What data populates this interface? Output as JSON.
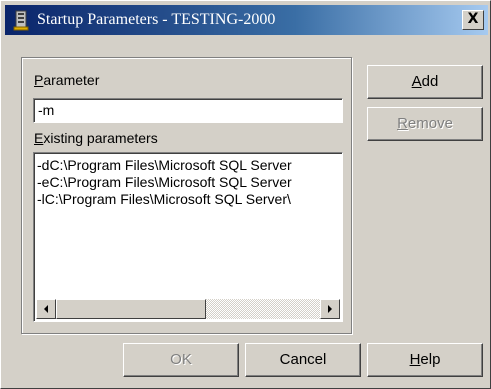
{
  "window": {
    "title": "Startup Parameters - TESTING-2000",
    "close_glyph": "X"
  },
  "parameter": {
    "label_mnemonic": "P",
    "label_rest": "arameter",
    "value": "-m"
  },
  "existing": {
    "label_mnemonic": "E",
    "label_rest": "xisting parameters",
    "items": [
      "-dC:\\Program Files\\Microsoft SQL Server",
      "-eC:\\Program Files\\Microsoft SQL Server",
      "-lC:\\Program Files\\Microsoft SQL Server\\"
    ]
  },
  "buttons": {
    "add": {
      "mnemonic": "A",
      "rest": "dd"
    },
    "remove": {
      "mnemonic": "R",
      "rest": "emove"
    },
    "ok": "OK",
    "cancel": "Cancel",
    "help": {
      "mnemonic": "H",
      "rest": "elp"
    }
  },
  "icons": {
    "app": "startup-parameters-icon",
    "scroll_left": "scroll-left-arrow-icon",
    "scroll_right": "scroll-right-arrow-icon"
  },
  "colors": {
    "face": "#d4d0c8",
    "title_start": "#0a246a",
    "title_end": "#a6caf0",
    "disabled_text": "#808080"
  }
}
